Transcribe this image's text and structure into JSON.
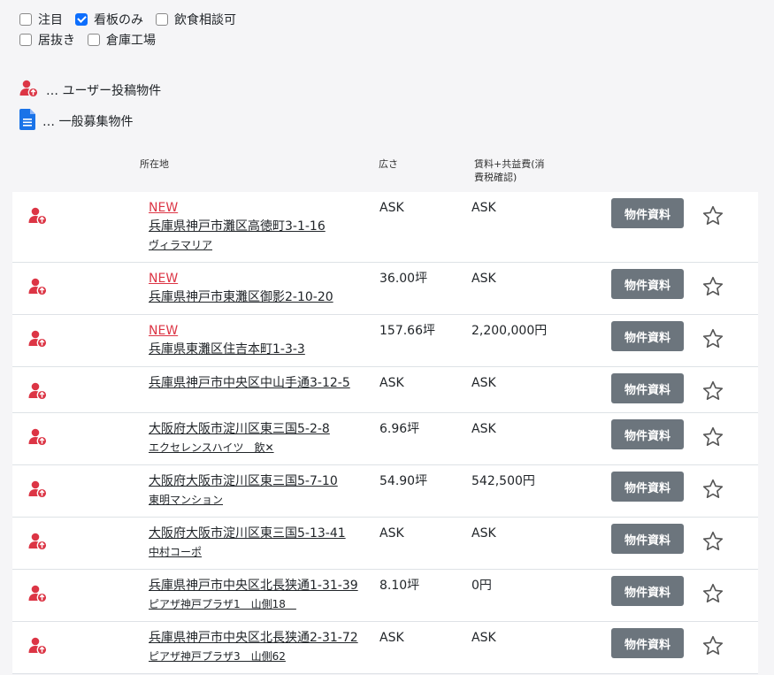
{
  "filters": [
    [
      {
        "label": "注目",
        "checked": false
      },
      {
        "label": "看板のみ",
        "checked": true
      },
      {
        "label": "飲食相談可",
        "checked": false
      }
    ],
    [
      {
        "label": "居抜き",
        "checked": false
      },
      {
        "label": "倉庫工場",
        "checked": false
      }
    ]
  ],
  "legend": {
    "user_post": "… ユーザー投稿物件",
    "general": "… 一般募集物件"
  },
  "columns": {
    "location": "所在地",
    "size": "広さ",
    "rent_line1": "賃料+共益費(消",
    "rent_line2": "費税確認)"
  },
  "button_label": "物件資料",
  "colors": {
    "accent_red": "#dc3545",
    "button_gray": "#6c757d",
    "checkbox_blue": "#0d6efd",
    "doc_blue": "#1a73e8"
  },
  "rows": [
    {
      "new": "NEW",
      "address": "兵庫県神戸市灘区高徳町3-1-16",
      "building": "ヴィラマリア",
      "size": "ASK",
      "price": "ASK"
    },
    {
      "new": "NEW",
      "address": "兵庫県神戸市東灘区御影2-10-20",
      "building": "",
      "size": "36.00坪",
      "price": "ASK"
    },
    {
      "new": "NEW",
      "address": "兵庫県東灘区住吉本町1-3-3",
      "building": "",
      "size": "157.66坪",
      "price": "2,200,000円"
    },
    {
      "new": "",
      "address": "兵庫県神戸市中央区中山手通3-12-5",
      "building": "",
      "size": "ASK",
      "price": "ASK"
    },
    {
      "new": "",
      "address": "大阪府大阪市淀川区東三国5-2-8",
      "building": "エクセレンスハイツ　飲✕",
      "size": "6.96坪",
      "price": "ASK"
    },
    {
      "new": "",
      "address": "大阪府大阪市淀川区東三国5-7-10",
      "building": "東明マンション",
      "size": "54.90坪",
      "price": "542,500円"
    },
    {
      "new": "",
      "address": "大阪府大阪市淀川区東三国5-13-41",
      "building": "中村コーポ",
      "size": "ASK",
      "price": "ASK"
    },
    {
      "new": "",
      "address": "兵庫県神戸市中央区北長狭通1-31-39",
      "building": "ピアザ神戸プラザ1　山側18　",
      "size": "8.10坪",
      "price": "0円"
    },
    {
      "new": "",
      "address": "兵庫県神戸市中央区北長狭通2-31-72",
      "building": "ピアザ神戸プラザ3　山側62",
      "size": "ASK",
      "price": "ASK"
    }
  ]
}
